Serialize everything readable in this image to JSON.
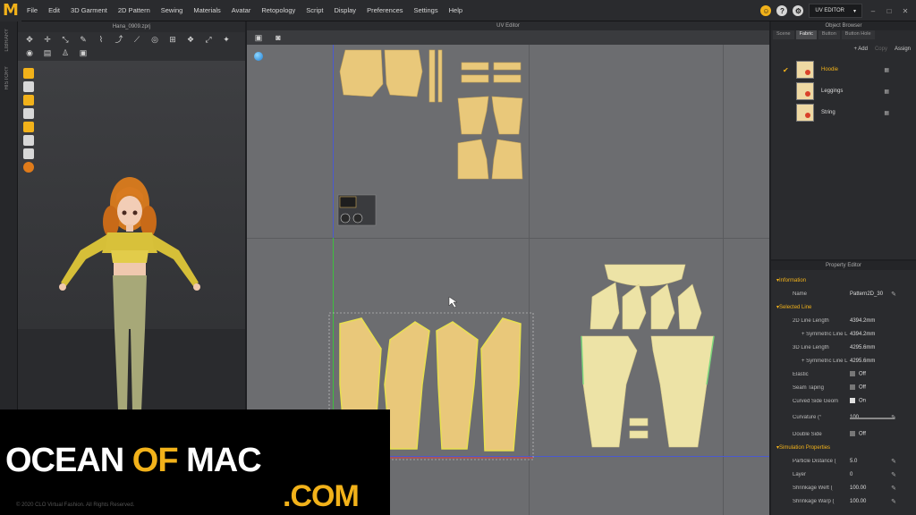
{
  "menubar": {
    "logo": "M",
    "items": [
      "File",
      "Edit",
      "3D Garment",
      "2D Pattern",
      "Sewing",
      "Materials",
      "Avatar",
      "Retopology",
      "Script",
      "Display",
      "Preferences",
      "Settings",
      "Help"
    ],
    "mode_label": "UV EDITOR",
    "mode_caret": "▾",
    "window_controls": [
      "–",
      "□",
      "✕"
    ]
  },
  "left_strip": {
    "labels": [
      "LIBRARY",
      "HISTORY"
    ]
  },
  "panel3d": {
    "title": "Hana_0909.zprj"
  },
  "uv_editor": {
    "title": "UV Editor"
  },
  "object_browser": {
    "title": "Object Browser",
    "tabs": [
      "Scene",
      "Fabric",
      "Button",
      "Button Hole"
    ],
    "active_tab": "Fabric",
    "actions": {
      "add": "+ Add",
      "copy": "Copy",
      "assign": "Assign"
    },
    "fabrics": [
      {
        "name": "Hoodie",
        "selected": true
      },
      {
        "name": "Leggings",
        "selected": false
      },
      {
        "name": "String",
        "selected": false
      }
    ]
  },
  "property_editor": {
    "title": "Property Editor",
    "rows": [
      {
        "type": "section",
        "label": "Information"
      },
      {
        "type": "field",
        "label": "Name",
        "value": "Pattern2D_30",
        "edit": true
      },
      {
        "type": "section",
        "label": "Selected Line"
      },
      {
        "type": "field",
        "label": "2D Line Length",
        "value": "4394.2mm"
      },
      {
        "type": "subfield",
        "label": "+ Symmetric Line L",
        "value": "4394.2mm"
      },
      {
        "type": "field",
        "label": "3D Line Length",
        "value": "4295.6mm"
      },
      {
        "type": "subfield",
        "label": "+ Symmetric Line L",
        "value": "4295.6mm"
      },
      {
        "type": "check",
        "label": "Elastic",
        "value": "Off"
      },
      {
        "type": "check",
        "label": "Seam Taping",
        "value": "Off"
      },
      {
        "type": "check",
        "label": "Curved Side Geom",
        "value": "On",
        "on": true
      },
      {
        "type": "slider",
        "label": "Curvature (°",
        "value": "100"
      },
      {
        "type": "check",
        "label": "Double Side",
        "value": "Off"
      },
      {
        "type": "section",
        "label": "Simulation Properties"
      },
      {
        "type": "field",
        "label": "Particle Distance (",
        "value": "5.0",
        "edit": true
      },
      {
        "type": "field",
        "label": "Layer",
        "value": "0",
        "edit": true
      },
      {
        "type": "field",
        "label": "Shrinkage Weft (",
        "value": "100.00",
        "edit": true
      },
      {
        "type": "field",
        "label": "Shrinkage Warp (",
        "value": "100.00",
        "edit": true
      }
    ]
  },
  "watermark": {
    "part1": "OCEAN ",
    "part2": "OF",
    "part3": " MAC",
    "part4": ".COM"
  },
  "copyright": "© 2020 CLO Virtual Fashion. All Rights Reserved."
}
